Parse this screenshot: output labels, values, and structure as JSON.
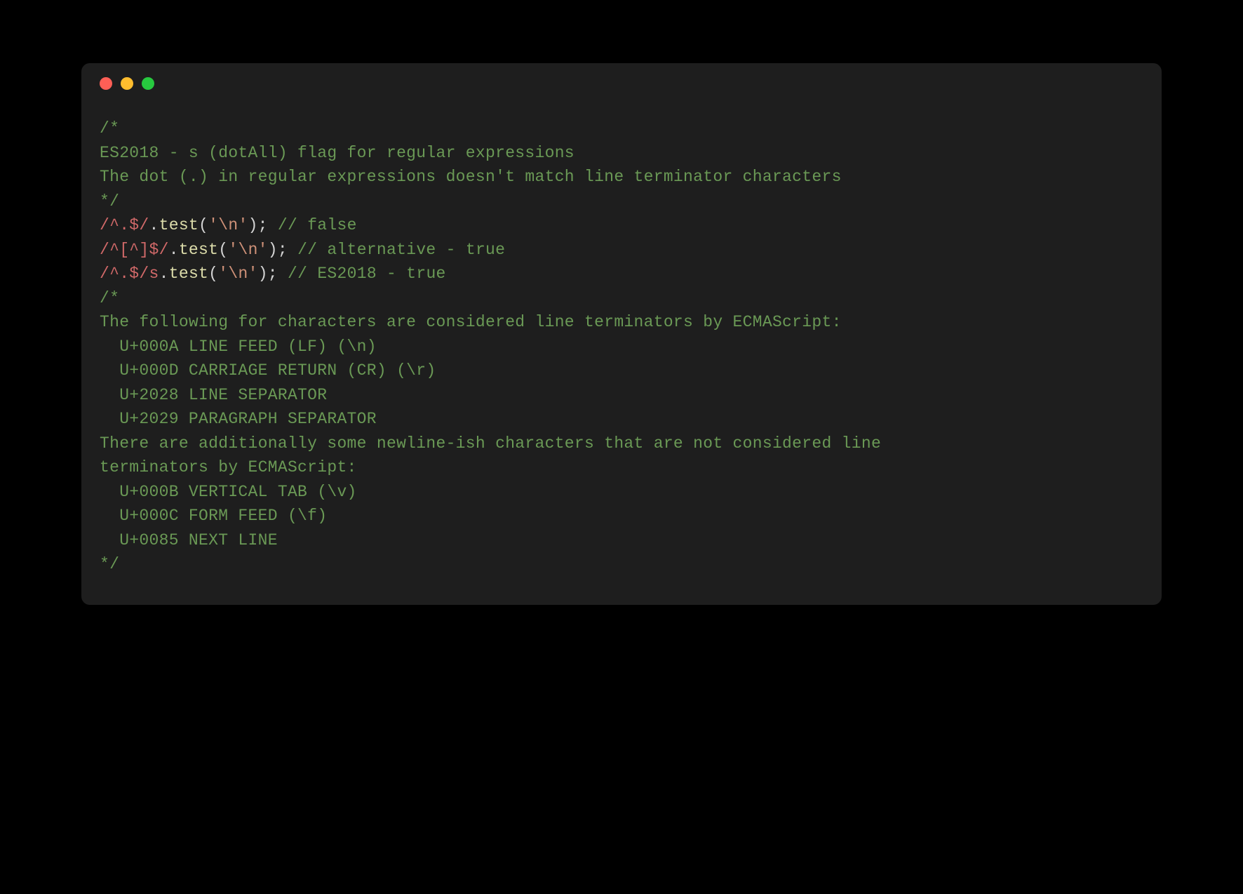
{
  "colors": {
    "bg": "#000000",
    "editor_bg": "#1e1e1e",
    "traffic_red": "#ff5f56",
    "traffic_yellow": "#ffbd2e",
    "traffic_green": "#27c93f",
    "comment": "#6a9955",
    "regex": "#d16969",
    "method": "#dcdcaa",
    "string": "#ce9178",
    "punct": "#d4d4d4"
  },
  "code": {
    "line1": "/*",
    "line2": "ES2018 - s (dotAll) flag for regular expressions",
    "line3": "",
    "line4": "The dot (.) in regular expressions doesn't match line terminator characters",
    "line5": "*/",
    "line6": "",
    "line7_regex": "/^.$/",
    "line7_dot": ".",
    "line7_method": "test",
    "line7_paren_o": "(",
    "line7_str": "'\\n'",
    "line7_paren_c": ");",
    "line7_comment": " // false",
    "line8_regex": "/^[^]$/",
    "line8_dot": ".",
    "line8_method": "test",
    "line8_paren_o": "(",
    "line8_str": "'\\n'",
    "line8_paren_c": ");",
    "line8_comment": " // alternative - true",
    "line9_regex": "/^.$/s",
    "line9_dot": ".",
    "line9_method": "test",
    "line9_paren_o": "(",
    "line9_str": "'\\n'",
    "line9_paren_c": ");",
    "line9_comment": " // ES2018 - true",
    "line10": "",
    "line11": "/*",
    "line12": "The following for characters are considered line terminators by ECMAScript:",
    "line13": "",
    "line14": "  U+000A LINE FEED (LF) (\\n)",
    "line15": "  U+000D CARRIAGE RETURN (CR) (\\r)",
    "line16": "  U+2028 LINE SEPARATOR",
    "line17": "  U+2029 PARAGRAPH SEPARATOR",
    "line18": "",
    "line19": "There are additionally some newline-ish characters that are not considered line",
    "line20": "terminators by ECMAScript:",
    "line21": "",
    "line22": "  U+000B VERTICAL TAB (\\v)",
    "line23": "  U+000C FORM FEED (\\f)",
    "line24": "  U+0085 NEXT LINE",
    "line25": "*/"
  }
}
